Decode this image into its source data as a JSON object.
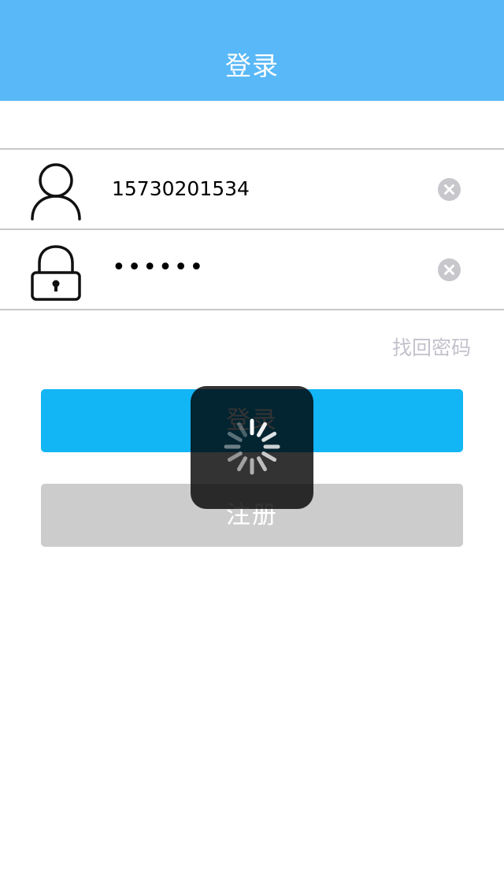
{
  "header": {
    "title": "登录"
  },
  "account": {
    "value": "15730201534",
    "icon": "user-icon",
    "clear_icon": "clear-icon"
  },
  "password": {
    "value": "••••••",
    "icon": "lock-icon",
    "clear_icon": "clear-icon"
  },
  "forgot_password": {
    "label": "找回密码"
  },
  "buttons": {
    "login_label": "登录",
    "register_label": "注册"
  },
  "loading": {
    "icon": "spinner-icon"
  },
  "colors": {
    "navbar": "#59b8f7",
    "login_button": "#12b6f5",
    "register_button": "#cccccc",
    "forgot_link": "#c2c2cc",
    "separator": "#c8c8cc"
  }
}
